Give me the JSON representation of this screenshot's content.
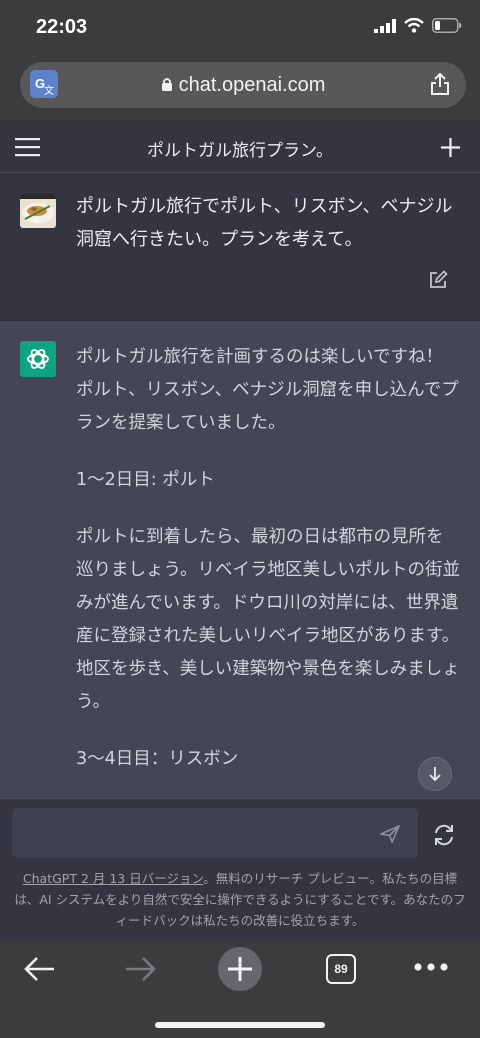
{
  "status_bar": {
    "time": "22:03"
  },
  "browser": {
    "url": "chat.openai.com"
  },
  "chat": {
    "title": "ポルトガル旅行プラン。"
  },
  "user_message": {
    "text": "ポルトガル旅行でポルト、リスボン、ベナジル洞窟へ行きたい。プランを考えて。"
  },
  "assistant_message": {
    "paragraphs": [
      "ポルトガル旅行を計画するのは楽しいですね！ポルト、リスボン、ベナジル洞窟を申し込んでプランを提案していました。",
      "1〜2日目: ポルト",
      "ポルトに到着したら、最初の日は都市の見所を巡りましょう。リベイラ地区美しいポルトの街並みが進んでいます。ドウロ川の対岸には、世界遺産に登録された美しいリベイラ地区があります。地区を歩き、美しい建築物や景色を楽しみましょう。",
      "3〜4日目：リスボン"
    ]
  },
  "composer": {
    "placeholder": ""
  },
  "footer": {
    "link": "ChatGPT 2 月 13 日バージョン",
    "text": "。無料のリサーチ プレビュー。私たちの目標は、AI システムをより自然で安全に操作できるようにすることです。あなたのフィードバックは私たちの改善に役立ちます。"
  },
  "toolbar": {
    "tab_count": "89"
  },
  "icons": {
    "translate": "translate-icon",
    "lock": "lock-icon",
    "share": "share-icon",
    "menu": "hamburger-menu-icon",
    "new_chat": "plus-icon",
    "edit": "edit-icon",
    "openai": "openai-logo-icon",
    "scroll": "arrow-down-icon",
    "send": "send-icon",
    "regenerate": "refresh-icon",
    "back": "back-arrow-icon",
    "forward": "forward-arrow-icon",
    "new_tab": "plus-icon",
    "tabs": "tabs-icon",
    "more": "more-icon"
  },
  "colors": {
    "accent": "#10a37f",
    "background": "#343541",
    "assistant_bg": "#444654"
  }
}
